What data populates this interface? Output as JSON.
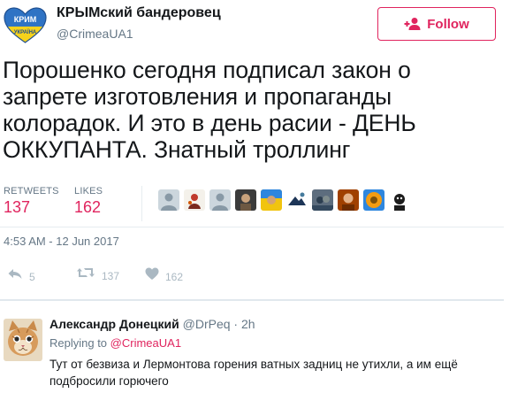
{
  "author": {
    "display_name": "КРЫМский бандеровец",
    "screen_name": "@CrimeaUA1",
    "avatar_text": [
      "КРИМ",
      "УКРАЇНА"
    ]
  },
  "follow_button": {
    "label": "Follow",
    "icon": "add-user-icon"
  },
  "tweet": {
    "text": "Порошенко сегодня подписал закон о запрете изготовления и пропаганды колорадок. И это в день расии - ДЕНЬ ОККУПАНТА. Знатный троллинг",
    "retweets_label": "RETWEETS",
    "retweets_count": "137",
    "likes_label": "LIKES",
    "likes_count": "162",
    "timestamp": "4:53 AM - 12 Jun 2017"
  },
  "actions": {
    "reply": {
      "icon": "reply-icon",
      "count": "5"
    },
    "retweet": {
      "icon": "retweet-icon",
      "count": "137"
    },
    "like": {
      "icon": "heart-icon",
      "count": "162"
    }
  },
  "reply": {
    "author_name": "Александр Донецкий",
    "author_handle": "@DrPeq",
    "separator": "·",
    "age": "2h",
    "replying_prefix": "Replying to",
    "replying_to": "@CrimeaUA1",
    "text": "Тут от безвиза и Лермонтова горения ватных задниц не утихли, а им ещё подбросили горючего"
  },
  "colors": {
    "accent": "#e0245e",
    "secondary_text": "#657786",
    "icon_gray": "#aab8c2",
    "divider": "#e6ecf0"
  }
}
